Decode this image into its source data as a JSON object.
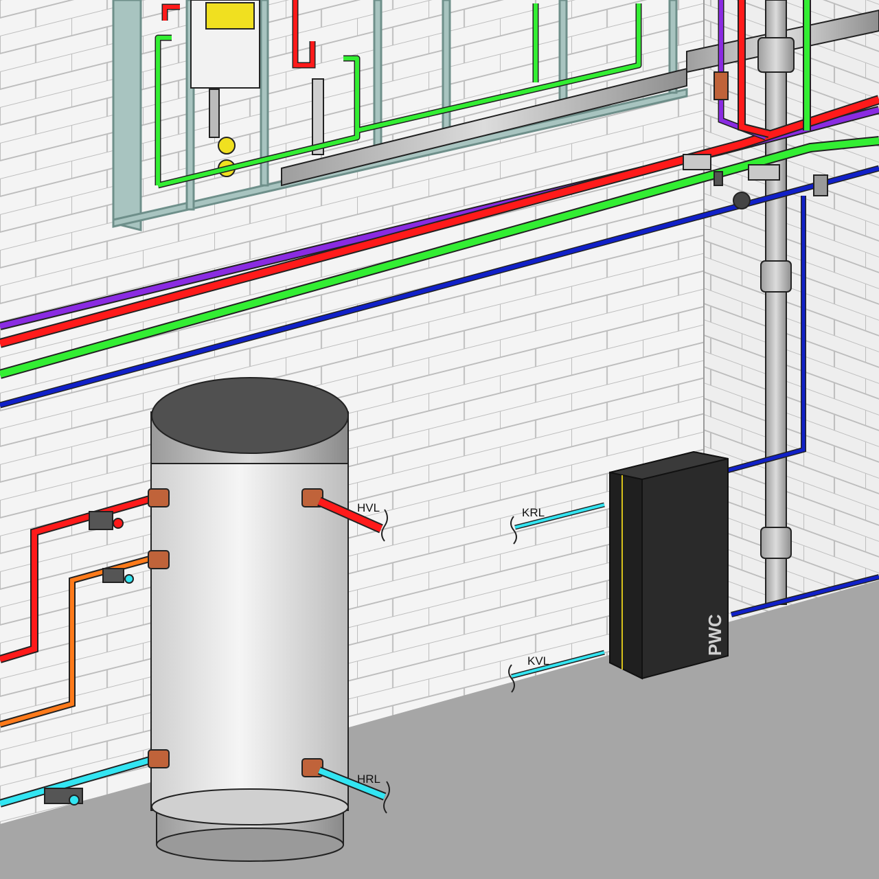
{
  "labels": {
    "hvl": "HVL",
    "hrl": "HRL",
    "krl": "KRL",
    "kvl": "KVL",
    "pwc": "PWC"
  },
  "colors": {
    "hot_flow": "#ff1a1a",
    "hot_return": "#8a2be2",
    "cold_drinking": "#33ee33",
    "cold_network": "#1020c8",
    "cooling": "#33e5f2",
    "heating_return": "#ff7a1a",
    "tank_body": "#e6e6e6",
    "tank_cap": "#505050",
    "exchanger": "#2a2a2a",
    "drain_pipe": "#c8c8c8",
    "floor": "#a6a6a6",
    "wall": "#f2f2f2",
    "frame": "#a8c4c0"
  },
  "icons": [
    "ball-valve-icon",
    "strainer-valve-icon",
    "shutoff-valve-icon",
    "cistern-icon"
  ]
}
